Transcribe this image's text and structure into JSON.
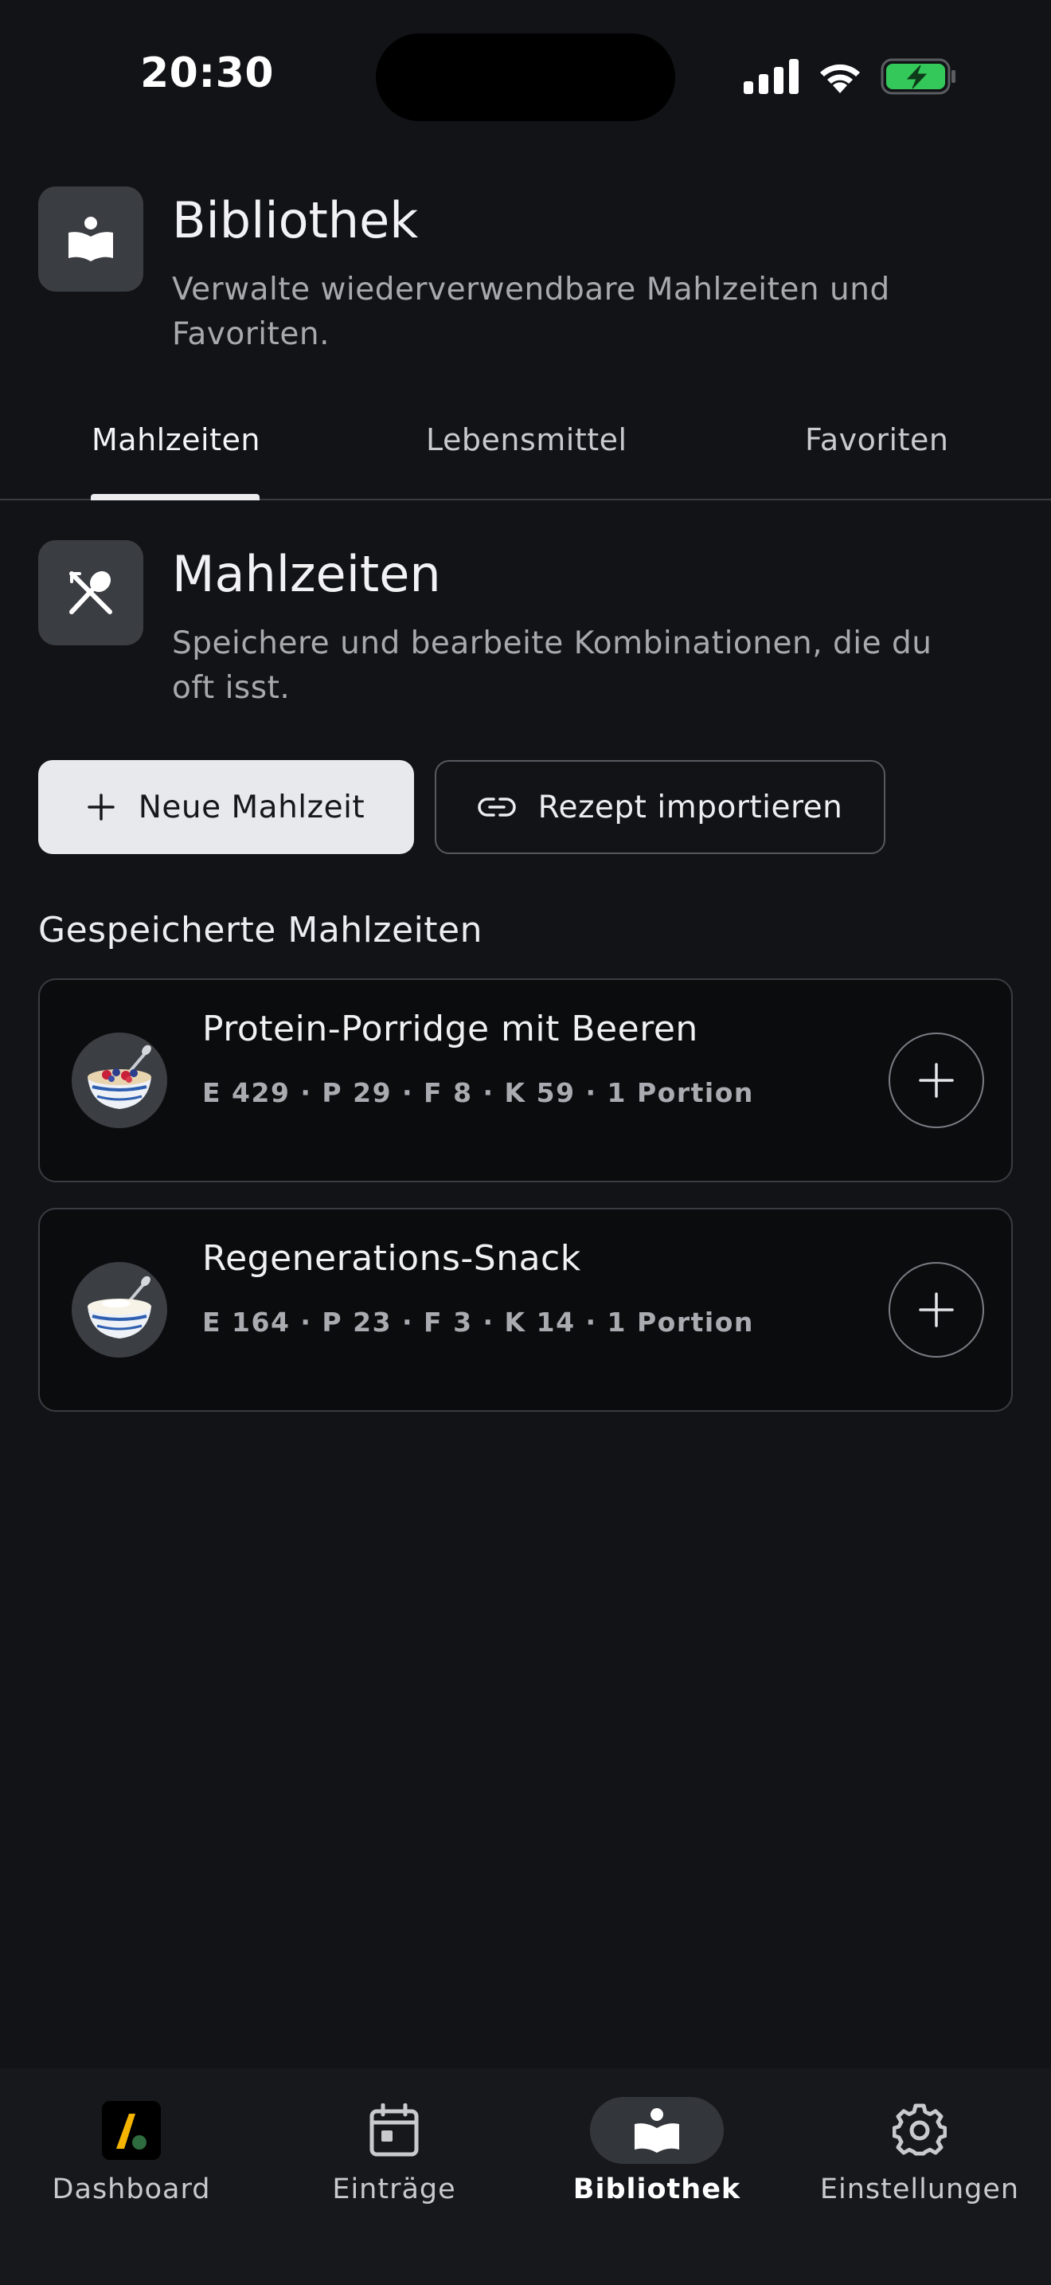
{
  "status_bar": {
    "time": "20:30",
    "signal_icon": "cellular-signal-icon",
    "wifi_icon": "wifi-icon",
    "battery_icon": "battery-charging-icon",
    "battery_color": "#34C759"
  },
  "header": {
    "icon": "book-reader-icon",
    "title": "Bibliothek",
    "subtitle": "Verwalte wiederverwendbare Mahlzeiten und Favoriten."
  },
  "tabs": [
    {
      "label": "Mahlzeiten",
      "active": true
    },
    {
      "label": "Lebensmittel",
      "active": false
    },
    {
      "label": "Favoriten",
      "active": false
    }
  ],
  "section": {
    "icon": "fork-spoon-icon",
    "title": "Mahlzeiten",
    "subtitle": "Speichere und bearbeite Kombinationen, die du oft isst."
  },
  "actions": {
    "new_meal_label": "Neue Mahlzeit",
    "import_recipe_label": "Rezept importieren"
  },
  "saved_meals": {
    "heading": "Gespeicherte Mahlzeiten",
    "items": [
      {
        "name": "Protein-Porridge mit Beeren",
        "macros": "E 429 · P 29 · F 8 · K 59 · 1 Portion",
        "icon": "porridge-berries-icon"
      },
      {
        "name": "Regenerations-Snack",
        "macros": "E 164 · P 23 · F 3 · K 14 · 1 Portion",
        "icon": "yogurt-bowl-icon"
      }
    ]
  },
  "bottom_nav": [
    {
      "label": "Dashboard",
      "icon": "app-logo-icon",
      "active": false
    },
    {
      "label": "Einträge",
      "icon": "calendar-icon",
      "active": false
    },
    {
      "label": "Bibliothek",
      "icon": "book-reader-icon",
      "active": true
    },
    {
      "label": "Einstellungen",
      "icon": "gear-icon",
      "active": false
    }
  ],
  "colors": {
    "background": "#121316",
    "primary_button": "#E8E9EC",
    "card_background": "#0B0C0E",
    "accent_logo": "#F5B400"
  }
}
